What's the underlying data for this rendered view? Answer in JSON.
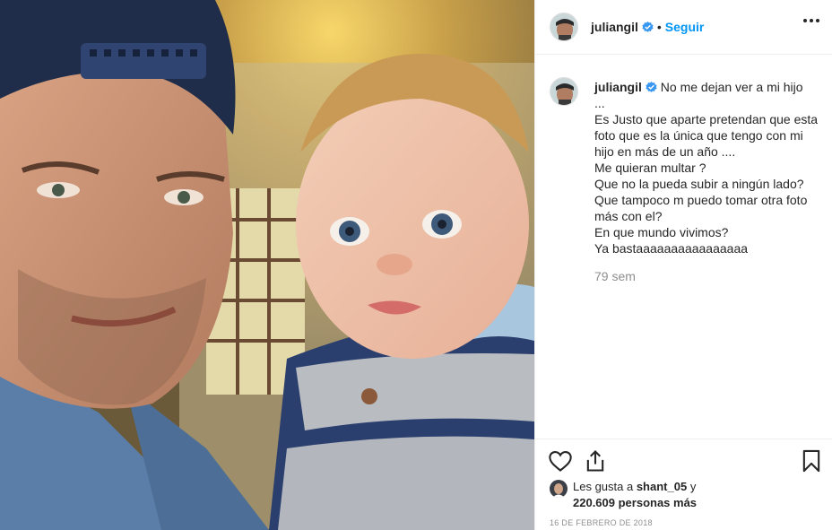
{
  "post": {
    "photo_icon": "post-photo",
    "username": "juliangil",
    "follow_label": "Seguir",
    "separator": "•",
    "more_icon": "more-options-icon",
    "verified_color": "#3897f0",
    "link_color": "#0095f6"
  },
  "caption": {
    "username": "juliangil",
    "text": "No me dejan ver a mi hijo\n...\nEs Justo que aparte pretendan que esta foto que es la única que tengo con mi hijo en más de un año ....\nMe quieran multar ?\nQue no la pueda subir a ningún lado?\nQue tampoco m puedo tomar otra foto más con el?\nEn que mundo vivimos?\nYa bastaaaaaaaaaaaaaaaa",
    "time": "79 sem"
  },
  "actions": {
    "like_icon": "heart-icon",
    "share_icon": "share-icon",
    "save_icon": "bookmark-icon"
  },
  "likes": {
    "prefix": "Les gusta a ",
    "first_user": "shant_05",
    "connector": " y",
    "count_text": "220.609 personas más"
  },
  "date": "16 DE FEBRERO DE 2018"
}
